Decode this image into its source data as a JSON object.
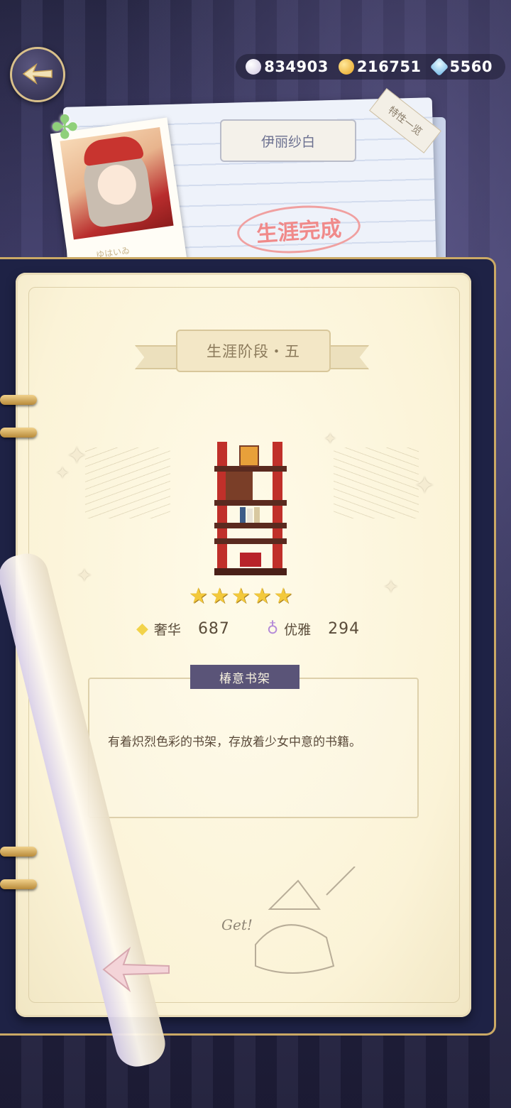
{
  "currency": [
    {
      "icon": "pearl-icon",
      "value": "834903",
      "color": "#e9e4f0"
    },
    {
      "icon": "gold-coin-icon",
      "value": "216751",
      "color": "#f2b733"
    },
    {
      "icon": "crystal-icon",
      "value": "5560",
      "color": "#8fd0f0"
    }
  ],
  "profile": {
    "name": "伊丽纱白",
    "status": "生涯完成",
    "traits_tab": "特性一览",
    "photo_caption": "ゆはいゐ"
  },
  "stage": {
    "title": "生涯阶段・五"
  },
  "item": {
    "rarity_stars": 5,
    "stars": [
      "★",
      "★",
      "★",
      "★",
      "★"
    ],
    "attributes": [
      {
        "icon": "diamond-icon",
        "label": "奢华",
        "value": "687",
        "color": "#f2d34a"
      },
      {
        "icon": "swan-icon",
        "label": "优雅",
        "value": "294",
        "color": "#b48ad8"
      }
    ],
    "name": "椿意书架",
    "description": "有着炽烈色彩的书架，存放着少女中意的书籍。"
  },
  "sketch": {
    "text": "Get!"
  }
}
